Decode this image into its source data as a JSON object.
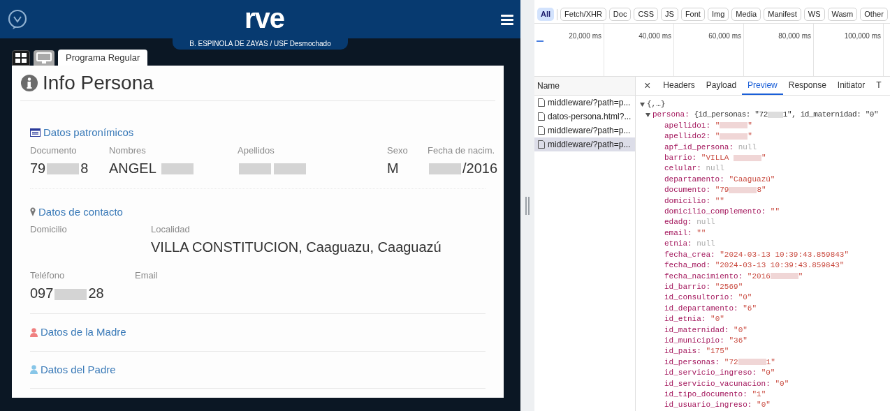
{
  "app": {
    "logo": "rve",
    "user_banner": "B. ESPINOLA DE ZAYAS / USF Desmochado",
    "tabs": [
      {
        "kind": "grid",
        "selected": false
      },
      {
        "kind": "monitor",
        "selected": false
      },
      {
        "kind": "text",
        "label": "Programa Regular",
        "selected": true
      }
    ],
    "title": "Info Persona",
    "sections": [
      {
        "kind": "fields",
        "heading": "Datos patronímicos",
        "rows": [
          [
            {
              "label": "Documento",
              "value": [
                {
                  "kind": "text",
                  "text": "79"
                },
                {
                  "kind": "redacted"
                },
                {
                  "kind": "text",
                  "text": "8"
                }
              ]
            },
            {
              "label": "Nombres",
              "value": [
                {
                  "kind": "text",
                  "text": "ANGEL "
                },
                {
                  "kind": "redacted"
                }
              ]
            },
            {
              "label": "Apellidos",
              "value": [
                {
                  "kind": "redacted"
                },
                {
                  "kind": "redacted"
                }
              ]
            },
            {
              "label": "Sexo",
              "value": [
                {
                  "kind": "text",
                  "text": "M"
                }
              ]
            },
            {
              "label": "Fecha de nacim.",
              "value": [
                {
                  "kind": "redacted"
                },
                {
                  "kind": "text",
                  "text": "/2016"
                }
              ]
            }
          ]
        ]
      },
      {
        "kind": "fields",
        "heading": "Datos de contacto",
        "rows": [
          [
            {
              "label": "Domicilio"
            },
            {
              "label": "Localidad",
              "value": [
                {
                  "kind": "text",
                  "text": "VILLA CONSTITUCION, Caaguazu, Caaguazú"
                }
              ]
            }
          ],
          [
            {
              "label": "Teléfono",
              "value": [
                {
                  "kind": "text",
                  "text": "097"
                },
                {
                  "kind": "redacted"
                },
                {
                  "kind": "text",
                  "text": "28"
                }
              ]
            },
            {
              "label": "Email"
            }
          ]
        ]
      },
      {
        "kind": "collapsed",
        "color": "#f08080",
        "heading": "Datos de la Madre"
      },
      {
        "kind": "collapsed",
        "color": "#87c6e8",
        "heading": "Datos del Padre"
      }
    ]
  },
  "devtools": {
    "filters": [
      {
        "label": "All",
        "selected": true
      },
      {
        "label": "Fetch/XHR",
        "selected": false
      },
      {
        "label": "Doc",
        "selected": false
      },
      {
        "label": "CSS",
        "selected": false
      },
      {
        "label": "JS",
        "selected": false
      },
      {
        "label": "Font",
        "selected": false
      },
      {
        "label": "Img",
        "selected": false
      },
      {
        "label": "Media",
        "selected": false
      },
      {
        "label": "Manifest",
        "selected": false
      },
      {
        "label": "WS",
        "selected": false
      },
      {
        "label": "Wasm",
        "selected": false
      },
      {
        "label": "Other",
        "selected": false
      }
    ],
    "timeline_ticks": [
      "20,000 ms",
      "40,000 ms",
      "60,000 ms",
      "80,000 ms",
      "100,000 ms"
    ],
    "name_header": "Name",
    "requests": [
      {
        "name": "middleware/?path=p...",
        "selected": false
      },
      {
        "name": "datos-persona.html?...",
        "selected": false
      },
      {
        "name": "middleware/?path=p...",
        "selected": false
      },
      {
        "name": "middleware/?path=p...",
        "selected": true
      }
    ],
    "close": "×",
    "detail_tabs": [
      {
        "label": "Headers",
        "selected": false
      },
      {
        "label": "Payload",
        "selected": false
      },
      {
        "label": "Preview",
        "selected": true
      },
      {
        "label": "Response",
        "selected": false
      },
      {
        "label": "Initiator",
        "selected": false
      },
      {
        "label": "T",
        "selected": false
      }
    ],
    "preview": {
      "root": "{,…}",
      "expanded": true,
      "children": [
        {
          "key": "persona:",
          "summary": [
            {
              "kind": "text",
              "text": "{id_personas: \"72"
            },
            {
              "kind": "redacted"
            },
            {
              "kind": "text",
              "text": "1\", id_maternidad: \"0\""
            }
          ],
          "expanded": true,
          "children": [
            {
              "key": "apellido1:",
              "kind": "string",
              "value": [
                {
                  "kind": "text",
                  "text": "\""
                },
                {
                  "kind": "redacted"
                },
                {
                  "kind": "text",
                  "text": "\""
                }
              ]
            },
            {
              "key": "apellido2:",
              "kind": "string",
              "value": [
                {
                  "kind": "text",
                  "text": "\""
                },
                {
                  "kind": "redacted"
                },
                {
                  "kind": "text",
                  "text": "\""
                }
              ]
            },
            {
              "key": "apf_id_persona:",
              "kind": "null",
              "value": [
                {
                  "kind": "text",
                  "text": "null"
                }
              ]
            },
            {
              "key": "barrio:",
              "kind": "string",
              "value": [
                {
                  "kind": "text",
                  "text": "\"VILLA "
                },
                {
                  "kind": "redacted"
                },
                {
                  "kind": "text",
                  "text": "\""
                }
              ]
            },
            {
              "key": "celular:",
              "kind": "null",
              "value": [
                {
                  "kind": "text",
                  "text": "null"
                }
              ]
            },
            {
              "key": "departamento:",
              "kind": "string",
              "value": [
                {
                  "kind": "text",
                  "text": "\"Caaguazú\""
                }
              ]
            },
            {
              "key": "documento:",
              "kind": "string",
              "value": [
                {
                  "kind": "text",
                  "text": "\"79"
                },
                {
                  "kind": "redacted"
                },
                {
                  "kind": "text",
                  "text": "8\""
                }
              ]
            },
            {
              "key": "domicilio:",
              "kind": "string",
              "value": [
                {
                  "kind": "text",
                  "text": "\"\""
                }
              ]
            },
            {
              "key": "domicilio_complemento:",
              "kind": "string",
              "value": [
                {
                  "kind": "text",
                  "text": "\"\""
                }
              ]
            },
            {
              "key": "edadg:",
              "kind": "null",
              "value": [
                {
                  "kind": "text",
                  "text": "null"
                }
              ]
            },
            {
              "key": "email:",
              "kind": "string",
              "value": [
                {
                  "kind": "text",
                  "text": "\"\""
                }
              ]
            },
            {
              "key": "etnia:",
              "kind": "null",
              "value": [
                {
                  "kind": "text",
                  "text": "null"
                }
              ]
            },
            {
              "key": "fecha_crea:",
              "kind": "string",
              "value": [
                {
                  "kind": "text",
                  "text": "\"2024-03-13 10:39:43.859843\""
                }
              ]
            },
            {
              "key": "fecha_mod:",
              "kind": "string",
              "value": [
                {
                  "kind": "text",
                  "text": "\"2024-03-13 10:39:43.859843\""
                }
              ]
            },
            {
              "key": "fecha_nacimiento:",
              "kind": "string",
              "value": [
                {
                  "kind": "text",
                  "text": "\"2016"
                },
                {
                  "kind": "redacted"
                },
                {
                  "kind": "text",
                  "text": "\""
                }
              ]
            },
            {
              "key": "id_barrio:",
              "kind": "string",
              "value": [
                {
                  "kind": "text",
                  "text": "\"2569\""
                }
              ]
            },
            {
              "key": "id_consultorio:",
              "kind": "string",
              "value": [
                {
                  "kind": "text",
                  "text": "\"0\""
                }
              ]
            },
            {
              "key": "id_departamento:",
              "kind": "string",
              "value": [
                {
                  "kind": "text",
                  "text": "\"6\""
                }
              ]
            },
            {
              "key": "id_etnia:",
              "kind": "string",
              "value": [
                {
                  "kind": "text",
                  "text": "\"0\""
                }
              ]
            },
            {
              "key": "id_maternidad:",
              "kind": "string",
              "value": [
                {
                  "kind": "text",
                  "text": "\"0\""
                }
              ]
            },
            {
              "key": "id_municipio:",
              "kind": "string",
              "value": [
                {
                  "kind": "text",
                  "text": "\"36\""
                }
              ]
            },
            {
              "key": "id_pais:",
              "kind": "string",
              "value": [
                {
                  "kind": "text",
                  "text": "\"175\""
                }
              ]
            },
            {
              "key": "id_personas:",
              "kind": "string",
              "value": [
                {
                  "kind": "text",
                  "text": "\"72"
                },
                {
                  "kind": "redacted"
                },
                {
                  "kind": "text",
                  "text": "1\""
                }
              ]
            },
            {
              "key": "id_servicio_ingreso:",
              "kind": "string",
              "value": [
                {
                  "kind": "text",
                  "text": "\"0\""
                }
              ]
            },
            {
              "key": "id_servicio_vacunacion:",
              "kind": "string",
              "value": [
                {
                  "kind": "text",
                  "text": "\"0\""
                }
              ]
            },
            {
              "key": "id_tipo_documento:",
              "kind": "string",
              "value": [
                {
                  "kind": "text",
                  "text": "\"1\""
                }
              ]
            },
            {
              "key": "id_usuario_ingreso:",
              "kind": "string",
              "value": [
                {
                  "kind": "text",
                  "text": "\"0\""
                }
              ]
            }
          ]
        }
      ]
    }
  }
}
